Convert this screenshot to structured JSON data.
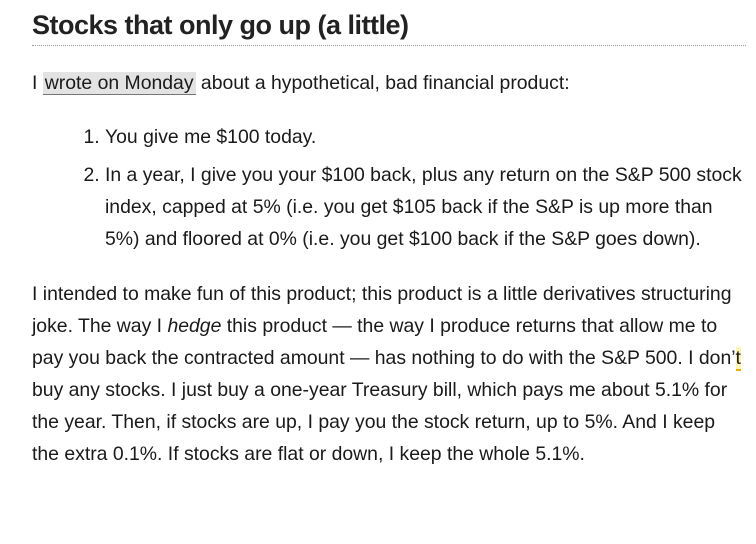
{
  "article": {
    "title": "Stocks that only go up (a little)",
    "intro": {
      "before": "I ",
      "link_text": "wrote on Monday",
      "after": " about a hypothetical, bad financial product:"
    },
    "list_items": [
      "You give me $100 today.",
      "In a year, I give you your $100 back, plus any return on the S&P 500 stock index, capped at 5% (i.e. you get $105 back if the S&P is up more than 5%) and floored at 0% (i.e. you get $100 back if the S&P goes down)."
    ],
    "body": {
      "part1": "I intended to make fun of this product; this product is a little derivatives structuring joke. The way I ",
      "italic": "hedge",
      "part2": " this product — the way I produce returns that allow me to pay you back the contracted amount — has nothing to do with the S&P 500. I don’",
      "highlight": "t",
      "part3": " buy any stocks. I just buy a one-year Treasury bill, which pays me about 5.1% for the year. Then, if stocks are up, I pay you the stock return, up to 5%. And I keep the extra 0.1%. If stocks are flat or down, I keep the whole 5.1%."
    }
  }
}
